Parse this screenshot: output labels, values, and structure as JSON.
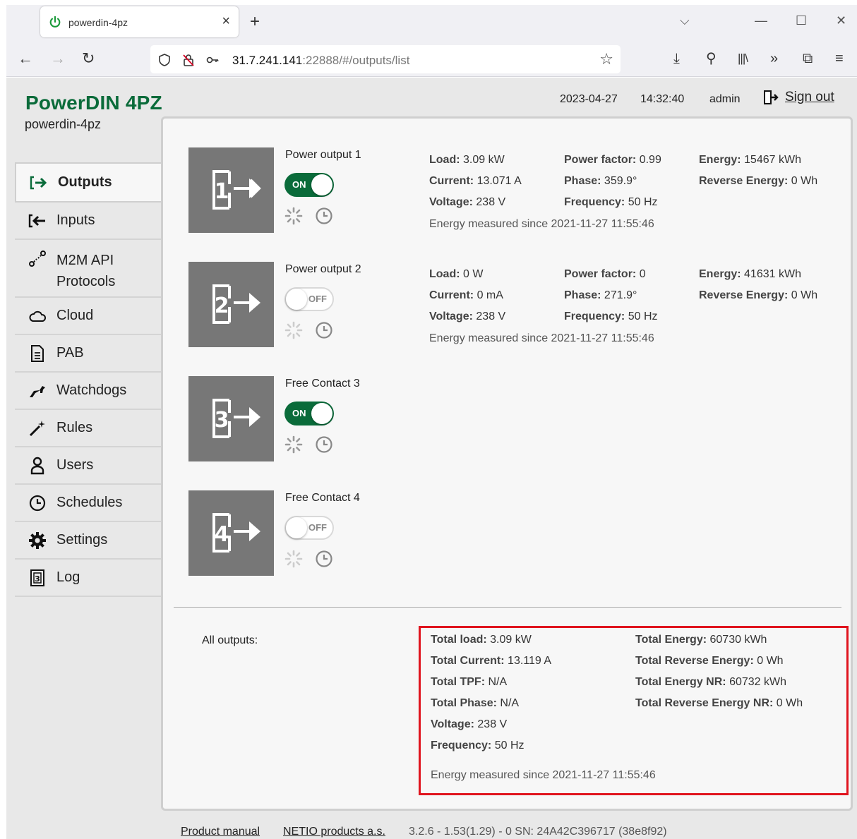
{
  "browser": {
    "tab_title": "powerdin-4pz",
    "url_host": "31.7.241.141",
    "url_rest": ":22888/#/outputs/list"
  },
  "header": {
    "brand": "PowerDIN 4PZ",
    "device_name": "powerdin-4pz",
    "date": "2023-04-27",
    "time": "14:32:40",
    "user": "admin",
    "sign_out": "Sign out"
  },
  "sidebar": {
    "items": [
      {
        "label": "Outputs",
        "icon": "output-arrow-icon"
      },
      {
        "label": "Inputs",
        "icon": "input-arrow-icon"
      },
      {
        "label": "M2M API",
        "label2": "Protocols",
        "icon": "m2m-api-icon"
      },
      {
        "label": "Cloud",
        "icon": "cloud-icon"
      },
      {
        "label": "PAB",
        "icon": "document-icon"
      },
      {
        "label": "Watchdogs",
        "icon": "watchdog-icon"
      },
      {
        "label": "Rules",
        "icon": "magic-wand-icon"
      },
      {
        "label": "Users",
        "icon": "user-icon"
      },
      {
        "label": "Schedules",
        "icon": "clock-icon"
      },
      {
        "label": "Settings",
        "icon": "gear-icon"
      },
      {
        "label": "Log",
        "icon": "log-icon"
      }
    ]
  },
  "outputs": [
    {
      "number": "1",
      "name": "Power output 1",
      "state": "ON",
      "load": "3.09 kW",
      "current": "13.071 A",
      "voltage": "238 V",
      "power_factor": "0.99",
      "phase": "359.9°",
      "frequency": "50 Hz",
      "energy": "15467 kWh",
      "reverse_energy": "0 Wh",
      "since": "Energy measured since 2021-11-27 11:55:46"
    },
    {
      "number": "2",
      "name": "Power output 2",
      "state": "OFF",
      "load": "0 W",
      "current": "0 mA",
      "voltage": "238 V",
      "power_factor": "0",
      "phase": "271.9°",
      "frequency": "50 Hz",
      "energy": "41631 kWh",
      "reverse_energy": "0 Wh",
      "since": "Energy measured since 2021-11-27 11:55:46"
    },
    {
      "number": "3",
      "name": "Free Contact 3",
      "state": "ON"
    },
    {
      "number": "4",
      "name": "Free Contact 4",
      "state": "OFF"
    }
  ],
  "labels": {
    "load": "Load:",
    "current": "Current:",
    "voltage": "Voltage:",
    "power_factor": "Power factor:",
    "phase": "Phase:",
    "frequency": "Frequency:",
    "energy": "Energy:",
    "reverse_energy": "Reverse Energy:",
    "on": "ON",
    "off": "OFF"
  },
  "totals": {
    "heading": "All outputs:",
    "rows_left": [
      {
        "label": "Total load:",
        "value": "3.09 kW"
      },
      {
        "label": "Total Current:",
        "value": "13.119 A"
      },
      {
        "label": "Total TPF:",
        "value": "N/A"
      },
      {
        "label": "Total Phase:",
        "value": "N/A"
      },
      {
        "label": "Voltage:",
        "value": "238 V"
      },
      {
        "label": "Frequency:",
        "value": "50 Hz"
      }
    ],
    "rows_right": [
      {
        "label": "Total Energy:",
        "value": "60730 kWh"
      },
      {
        "label": "Total Reverse Energy:",
        "value": "0 Wh"
      },
      {
        "label": "Total Energy NR:",
        "value": "60732 kWh"
      },
      {
        "label": "Total Reverse Energy NR:",
        "value": "0 Wh"
      }
    ],
    "since": "Energy measured since 2021-11-27 11:55:46"
  },
  "footer": {
    "manual": "Product manual",
    "company": "NETIO products a.s.",
    "version": "3.2.6 - 1.53(1.29) - 0 SN: 24A42C396717 (38e8f92)"
  },
  "colors": {
    "brand_green": "#0a6b3a",
    "tile_gray": "#777777",
    "highlight_red": "#e0141e"
  }
}
